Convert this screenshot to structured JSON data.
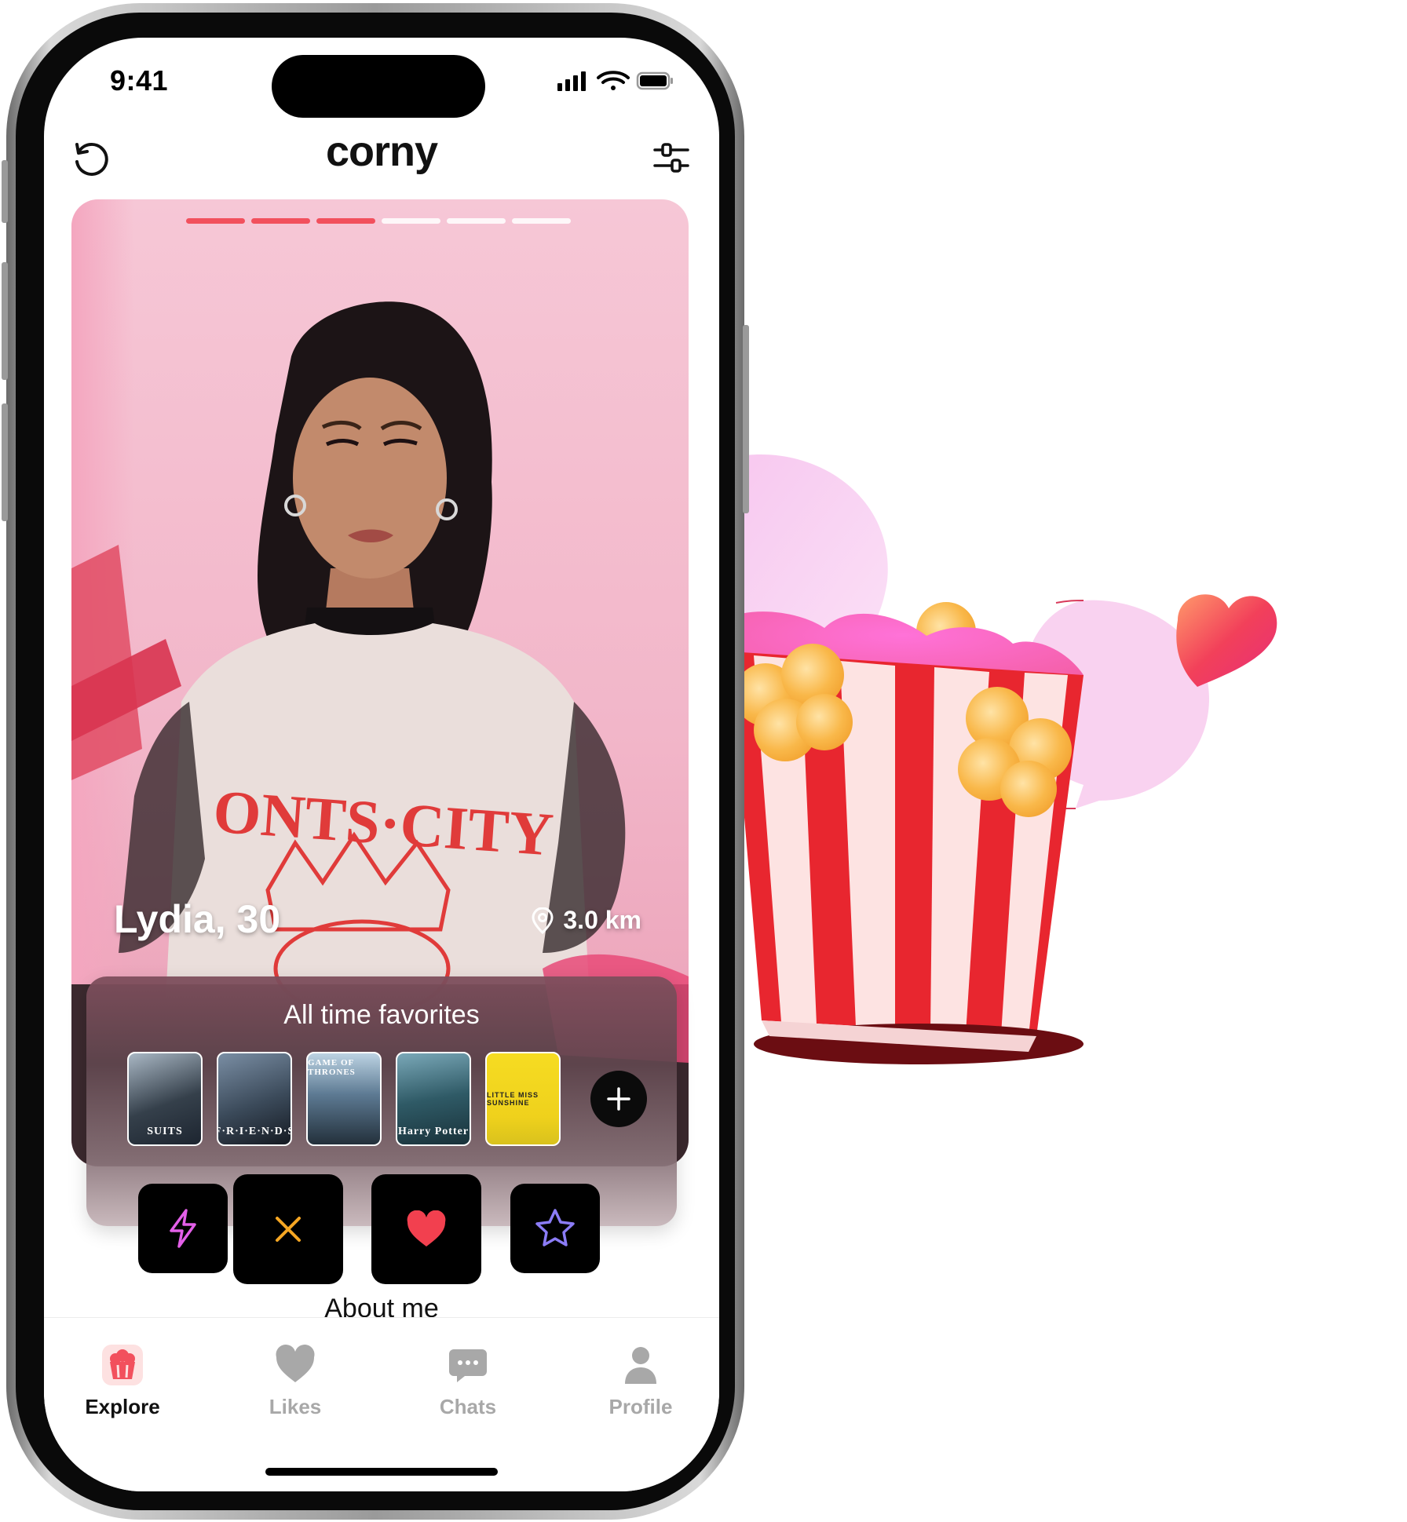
{
  "status_bar": {
    "time": "9:41"
  },
  "header": {
    "logo": "corny",
    "refresh_icon": "refresh-icon",
    "filter_icon": "sliders-icon"
  },
  "profile": {
    "name_age": "Lydia, 30",
    "distance": "3.0 km",
    "photo_count": 6,
    "current_photo_index": 3
  },
  "favorites": {
    "title": "All time favorites",
    "items": [
      {
        "label": "SUITS"
      },
      {
        "label": "F·R·I·E·N·D·S"
      },
      {
        "label": "GAME OF THRONES"
      },
      {
        "label": "Harry Potter"
      },
      {
        "label": "LITTLE MISS SUNSHINE"
      }
    ]
  },
  "actions": {
    "boost_icon": "lightning-icon",
    "dislike_icon": "close-icon",
    "like_icon": "heart-icon",
    "superlike_icon": "star-icon"
  },
  "about": {
    "title": "About me"
  },
  "tabbar": {
    "tabs": [
      {
        "label": "Explore",
        "icon": "popcorn-icon",
        "active": true
      },
      {
        "label": "Likes",
        "icon": "heart-icon",
        "active": false
      },
      {
        "label": "Chats",
        "icon": "chat-icon",
        "active": false
      },
      {
        "label": "Profile",
        "icon": "person-icon",
        "active": false
      }
    ]
  },
  "colors": {
    "accent": "#f2505d",
    "card_bg": "#f4bccd",
    "boost": "#e35fe8",
    "dislike": "#f5a623",
    "like": "#f2404f",
    "superlike": "#8b7cf6"
  }
}
